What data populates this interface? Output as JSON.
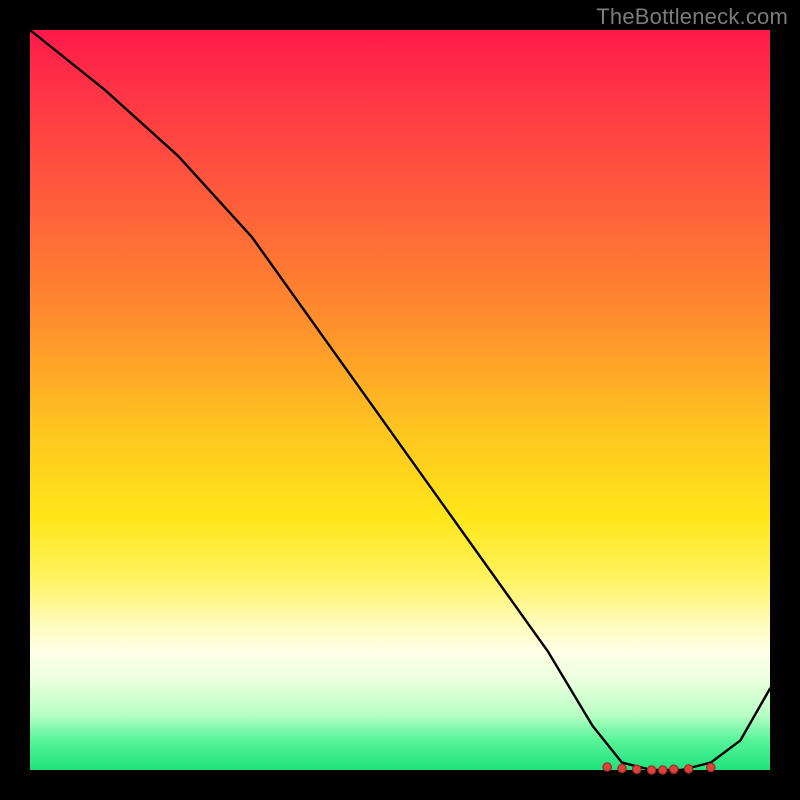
{
  "watermark": "TheBottleneck.com",
  "chart_data": {
    "type": "line",
    "title": "",
    "xlabel": "",
    "ylabel": "",
    "xlim": [
      0,
      100
    ],
    "ylim": [
      0,
      100
    ],
    "series": [
      {
        "name": "curve",
        "x": [
          0,
          10,
          20,
          30,
          40,
          50,
          60,
          70,
          76,
          80,
          84,
          88,
          92,
          96,
          100
        ],
        "values": [
          100,
          92,
          83,
          72,
          58,
          44,
          30,
          16,
          6,
          1,
          0,
          0,
          1,
          4,
          11
        ]
      }
    ],
    "markers": {
      "x": [
        78,
        80,
        82,
        84,
        85.5,
        87,
        89,
        92
      ],
      "values": [
        0.4,
        0.2,
        0.1,
        0.0,
        0.0,
        0.1,
        0.15,
        0.35
      ]
    },
    "gradient_stops": [
      {
        "pct": 0,
        "color": "#ff1a4a"
      },
      {
        "pct": 8,
        "color": "#ff3346"
      },
      {
        "pct": 22,
        "color": "#ff5a3c"
      },
      {
        "pct": 38,
        "color": "#ff8a2e"
      },
      {
        "pct": 55,
        "color": "#ffc81f"
      },
      {
        "pct": 66,
        "color": "#ffe61a"
      },
      {
        "pct": 74,
        "color": "#fff35e"
      },
      {
        "pct": 80,
        "color": "#fffbb8"
      },
      {
        "pct": 84,
        "color": "#ffffe6"
      },
      {
        "pct": 88,
        "color": "#e9ffdd"
      },
      {
        "pct": 92.5,
        "color": "#b9ffc3"
      },
      {
        "pct": 96,
        "color": "#57f49a"
      },
      {
        "pct": 100,
        "color": "#1fe27a"
      }
    ],
    "curve_color": "#000000",
    "marker_color": "#e0413c"
  }
}
